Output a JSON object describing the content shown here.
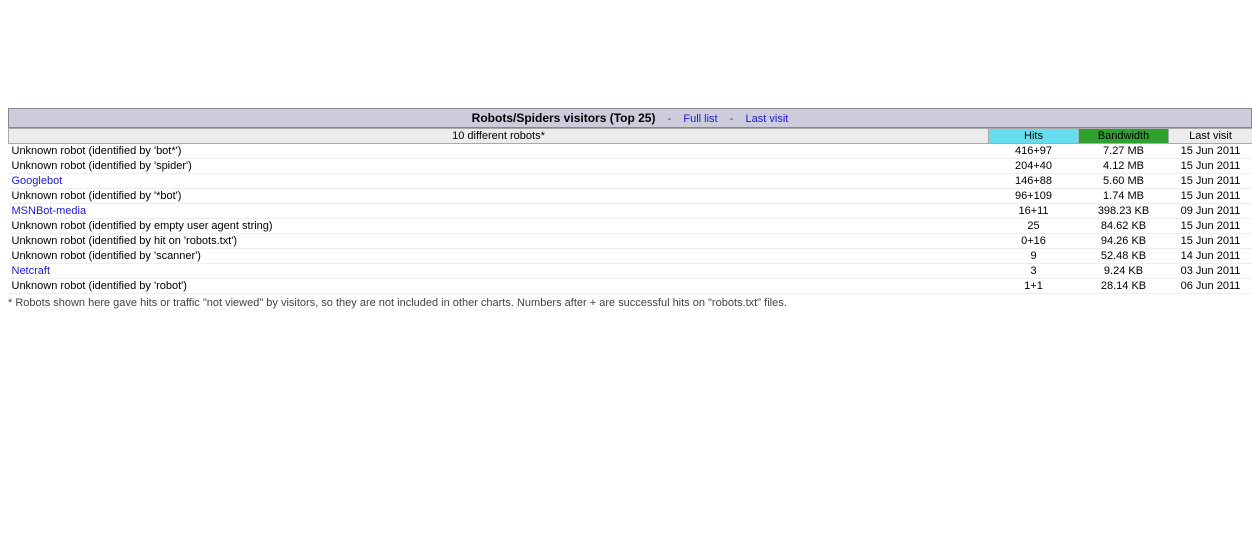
{
  "section": {
    "title": "Robots/Spiders visitors (Top 25)",
    "link_full": "Full list",
    "link_last": "Last visit"
  },
  "headers": {
    "caption": "10 different robots*",
    "hits": "Hits",
    "bandwidth": "Bandwidth",
    "last": "Last visit"
  },
  "rows": [
    {
      "name": "Unknown robot (identified by 'bot*')",
      "link": false,
      "hits": "416+97",
      "bw": "7.27 MB",
      "last": "15 Jun 2011"
    },
    {
      "name": "Unknown robot (identified by 'spider')",
      "link": false,
      "hits": "204+40",
      "bw": "4.12 MB",
      "last": "15 Jun 2011"
    },
    {
      "name": "Googlebot",
      "link": true,
      "hits": "146+88",
      "bw": "5.60 MB",
      "last": "15 Jun 2011"
    },
    {
      "name": "Unknown robot (identified by '*bot')",
      "link": false,
      "hits": "96+109",
      "bw": "1.74 MB",
      "last": "15 Jun 2011"
    },
    {
      "name": "MSNBot-media",
      "link": true,
      "hits": "16+11",
      "bw": "398.23 KB",
      "last": "09 Jun 2011"
    },
    {
      "name": "Unknown robot (identified by empty user agent string)",
      "link": false,
      "hits": "25",
      "bw": "84.62 KB",
      "last": "15 Jun 2011"
    },
    {
      "name": "Unknown robot (identified by hit on 'robots.txt')",
      "link": false,
      "hits": "0+16",
      "bw": "94.26 KB",
      "last": "15 Jun 2011"
    },
    {
      "name": "Unknown robot (identified by 'scanner')",
      "link": false,
      "hits": "9",
      "bw": "52.48 KB",
      "last": "14 Jun 2011"
    },
    {
      "name": "Netcraft",
      "link": true,
      "hits": "3",
      "bw": "9.24 KB",
      "last": "03 Jun 2011"
    },
    {
      "name": "Unknown robot (identified by 'robot')",
      "link": false,
      "hits": "1+1",
      "bw": "28.14 KB",
      "last": "06 Jun 2011"
    }
  ],
  "footnote": "* Robots shown here gave hits or traffic \"not viewed\" by visitors, so they are not included in other charts. Numbers after + are successful hits on \"robots.txt\" files."
}
